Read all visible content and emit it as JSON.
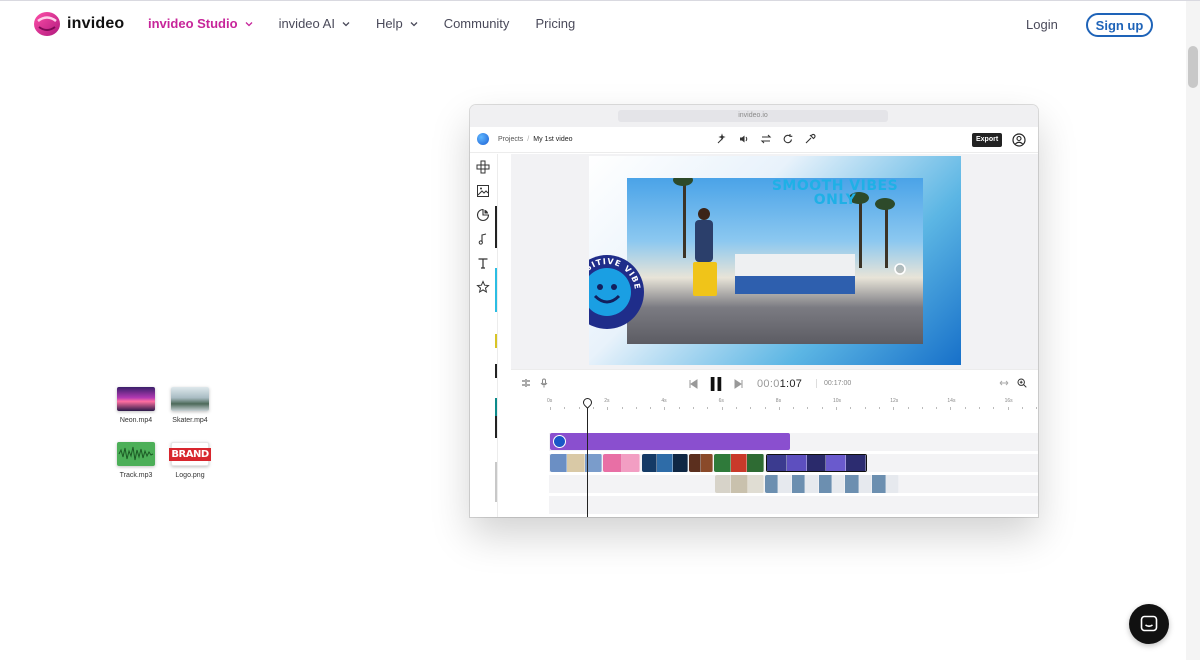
{
  "brand": {
    "name": "invideo",
    "accent": "#c7259a",
    "link_color": "#1e63b8"
  },
  "nav": {
    "items": [
      {
        "label": "invideo Studio",
        "has_dropdown": true,
        "active": true
      },
      {
        "label": "invideo AI",
        "has_dropdown": true,
        "active": false
      },
      {
        "label": "Help",
        "has_dropdown": true,
        "active": false
      },
      {
        "label": "Community",
        "has_dropdown": false,
        "active": false
      },
      {
        "label": "Pricing",
        "has_dropdown": false,
        "active": false
      }
    ],
    "login": "Login",
    "signup": "Sign up"
  },
  "assets": [
    {
      "caption": "Neon.mp4",
      "kind": "video"
    },
    {
      "caption": "Skater.mp4",
      "kind": "video"
    },
    {
      "caption": "Track.mp3",
      "kind": "audio"
    },
    {
      "caption": "Logo.png",
      "kind": "image",
      "thumb_text": "BRAND"
    }
  ],
  "editor": {
    "url": "invideo.io",
    "breadcrumb": {
      "root": "Projects",
      "separator": "/",
      "current": "My 1st video"
    },
    "export_label": "Export",
    "headline": [
      "SMOOTH VIBES",
      "ONLY"
    ],
    "sticker_text": "POSITIVE VIBES",
    "timeline": {
      "timecode_dim": "00:0",
      "timecode": "1:07",
      "duration": "00:17:00",
      "ruler": [
        "0s",
        "2s",
        "4s",
        "6s",
        "8s",
        "10s",
        "12s",
        "14s",
        "16s"
      ],
      "playhead_seconds": 1.3
    }
  }
}
